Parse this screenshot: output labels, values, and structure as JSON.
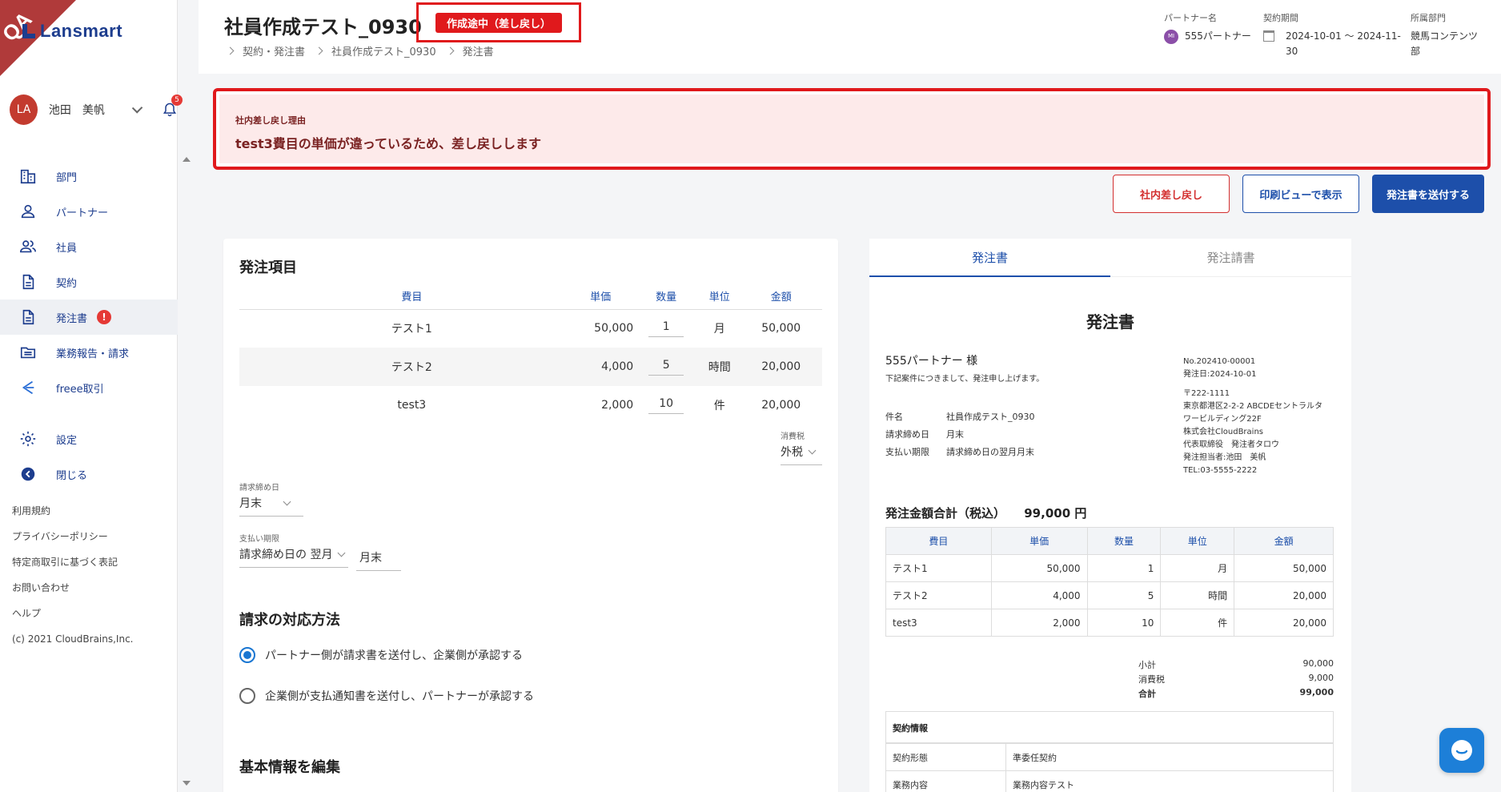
{
  "app": {
    "qa_label": "QA",
    "logo": "Lansmart"
  },
  "user": {
    "initials": "LA",
    "name": "池田　美帆",
    "notifications": "5"
  },
  "sidebar": {
    "items": [
      {
        "label": "部門",
        "icon": "building-icon"
      },
      {
        "label": "パートナー",
        "icon": "person-icon"
      },
      {
        "label": "社員",
        "icon": "people-icon"
      },
      {
        "label": "契約",
        "icon": "document-icon"
      },
      {
        "label": "発注書",
        "icon": "document-icon",
        "alert": "!"
      },
      {
        "label": "業務報告・請求",
        "icon": "folder-icon"
      },
      {
        "label": "freee取引",
        "icon": "freee-icon"
      },
      {
        "label": "設定",
        "icon": "gear-icon"
      },
      {
        "label": "閉じる",
        "icon": "back-arrow-icon"
      }
    ],
    "footer": [
      "利用規約",
      "プライバシーポリシー",
      "特定商取引に基づく表記",
      "お問い合わせ",
      "ヘルプ"
    ],
    "copyright": "(c) 2021 CloudBrains,Inc."
  },
  "header": {
    "title": "社員作成テスト_0930",
    "status": "作成途中（差し戻し）",
    "breadcrumb": [
      "契約・発注書",
      "社員作成テスト_0930",
      "発注書"
    ],
    "partner_label": "パートナー名",
    "partner_badge": "MI",
    "partner_value": "555パートナー",
    "period_label": "契約期間",
    "period_value_1": "2024-10-01 〜 2024-11-",
    "period_value_2": "30",
    "dept_label": "所属部門",
    "dept_value_1": "競馬コンテンツ",
    "dept_value_2": "部"
  },
  "reason": {
    "label": "社内差し戻し理由",
    "text": "test3費目の単価が違っているため、差し戻しします"
  },
  "actions": {
    "reject": "社内差し戻し",
    "print": "印刷ビューで表示",
    "send": "発注書を送付する"
  },
  "order": {
    "title": "発注項目",
    "columns": [
      "費目",
      "単価",
      "数量",
      "単位",
      "金額"
    ],
    "rows": [
      {
        "item": "テスト1",
        "price": "50,000",
        "qty": "1",
        "unit": "月",
        "amount": "50,000"
      },
      {
        "item": "テスト2",
        "price": "4,000",
        "qty": "5",
        "unit": "時間",
        "amount": "20,000"
      },
      {
        "item": "test3",
        "price": "2,000",
        "qty": "10",
        "unit": "件",
        "amount": "20,000"
      }
    ],
    "tax_label": "消費税",
    "tax_value": "外税",
    "closing_label": "請求締め日",
    "closing_value": "月末",
    "payment_label": "支払い期限",
    "payment_value": "請求締め日の 翌月",
    "payment_day": "月末",
    "billing_title": "請求の対応方法",
    "billing_options": [
      "パートナー側が請求書を送付し、企業側が承認する",
      "企業側が支払通知書を送付し、パートナーが承認する"
    ],
    "basic_title": "基本情報を編集"
  },
  "preview": {
    "tabs": [
      "発注書",
      "発注請書"
    ],
    "doc_title": "発注書",
    "to": "555パートナー 様",
    "intro": "下記案件につきまして、発注申し上げます。",
    "number": "No.202410-00001",
    "date": "発注日:2024-10-01",
    "addr_lines": [
      "〒222-1111",
      "東京都港区2-2-2 ABCDEセントラルタ",
      "ワービルディング22F",
      "株式会社CloudBrains",
      "代表取締役　発注者タロウ",
      "発注担当者:池田　美帆",
      "TEL:03-5555-2222"
    ],
    "fields": [
      {
        "label": "件名",
        "value": "社員作成テスト_0930"
      },
      {
        "label": "請求締め日",
        "value": "月末"
      },
      {
        "label": "支払い期限",
        "value": "請求締め日の翌月月末"
      }
    ],
    "total_label": "発注金額合計（税込）",
    "total_value": "99,000 円",
    "columns": [
      "費目",
      "単価",
      "数量",
      "単位",
      "金額"
    ],
    "rows": [
      {
        "item": "テスト1",
        "price": "50,000",
        "qty": "1",
        "unit": "月",
        "amount": "50,000"
      },
      {
        "item": "テスト2",
        "price": "4,000",
        "qty": "5",
        "unit": "時間",
        "amount": "20,000"
      },
      {
        "item": "test3",
        "price": "2,000",
        "qty": "10",
        "unit": "件",
        "amount": "20,000"
      }
    ],
    "subtotal_label": "小計",
    "subtotal": "90,000",
    "tax_label": "消費税",
    "tax": "9,000",
    "grand_label": "合計",
    "grand": "99,000",
    "contract_title": "契約情報",
    "contract_rows": [
      {
        "label": "契約形態",
        "value": "準委任契約"
      },
      {
        "label": "業務内容",
        "value": "業務内容テスト"
      }
    ]
  },
  "colors": {
    "accent": "#1d4faa",
    "alert": "#e0191c",
    "reason_bg": "#fdeaea"
  }
}
